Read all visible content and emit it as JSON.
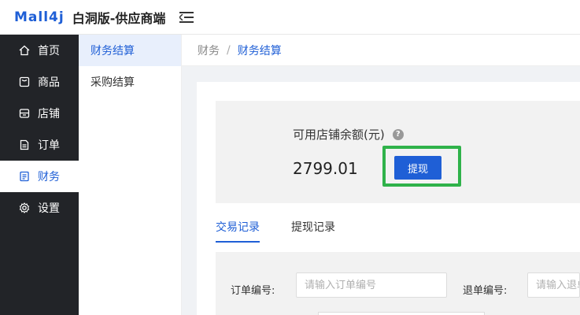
{
  "header": {
    "logo_text": "Mall4j",
    "app_title": "白洞版-供应商端"
  },
  "sidebar": {
    "items": [
      {
        "label": "首页",
        "icon": "home-icon"
      },
      {
        "label": "商品",
        "icon": "product-icon"
      },
      {
        "label": "店铺",
        "icon": "store-icon"
      },
      {
        "label": "订单",
        "icon": "order-icon"
      },
      {
        "label": "财务",
        "icon": "finance-icon",
        "active": true
      },
      {
        "label": "设置",
        "icon": "gear-icon"
      }
    ]
  },
  "submenu": {
    "items": [
      {
        "label": "财务结算",
        "active": true
      },
      {
        "label": "采购结算"
      }
    ]
  },
  "breadcrumb": {
    "parent": "财务",
    "separator": "/",
    "current": "财务结算"
  },
  "balance": {
    "label": "可用店铺余额(元)",
    "help": "?",
    "value": "2799.01",
    "withdraw_label": "提现"
  },
  "tabs": [
    {
      "label": "交易记录",
      "active": true
    },
    {
      "label": "提现记录"
    }
  ],
  "search": {
    "order_no_label": "订单编号:",
    "order_no_placeholder": "请输入订单编号",
    "refund_no_label": "退单编号:",
    "refund_no_placeholder": "请输入退单编号"
  },
  "colors": {
    "accent": "#1f5fd6",
    "sidebar_bg": "#222428",
    "highlight": "#2fb24a"
  }
}
